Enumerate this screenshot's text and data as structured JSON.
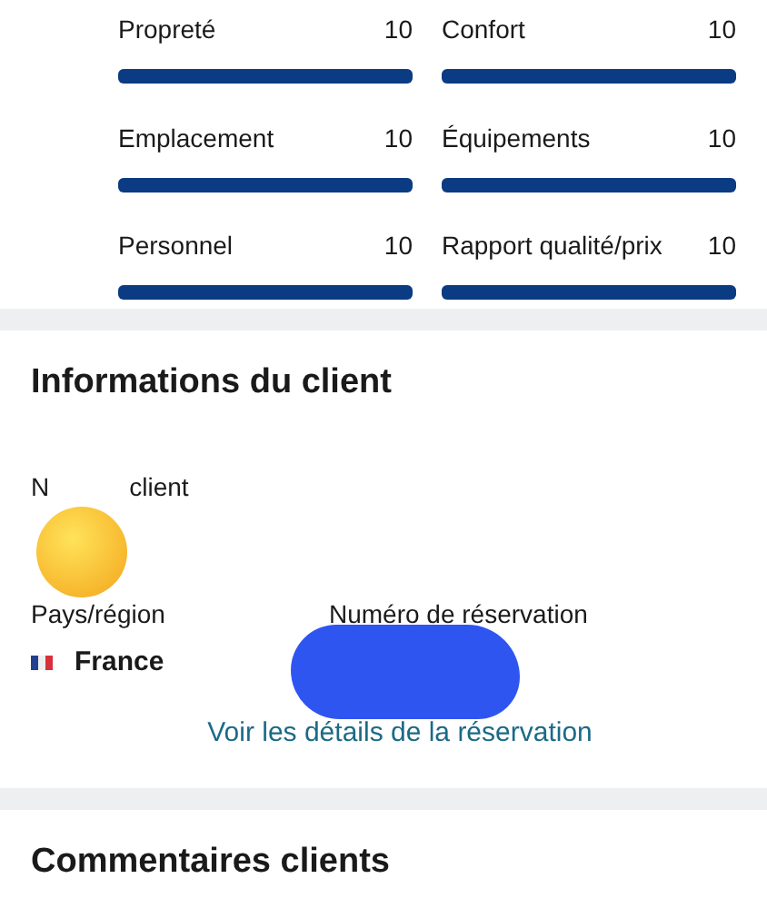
{
  "ratings": [
    {
      "label": "Propreté",
      "score": "10",
      "level": 1
    },
    {
      "label": "Confort",
      "score": "10",
      "level": 1
    },
    {
      "label": "Emplacement",
      "score": "10",
      "level": 1
    },
    {
      "label": "Équipements",
      "score": "10",
      "level": 1
    },
    {
      "label": "Personnel",
      "score": "10",
      "level": 1
    },
    {
      "label": "Rapport qualité/prix",
      "score": "10",
      "level": 1
    }
  ],
  "client_info": {
    "title": "Informations du client",
    "name_label_visible_parts": [
      "N",
      "client"
    ],
    "country_label": "Pays/région",
    "country": "France",
    "reservation_label": "Numéro de réservation",
    "link": "Voir les détails de la réservation"
  },
  "reviews": {
    "title": "Commentaires clients"
  }
}
